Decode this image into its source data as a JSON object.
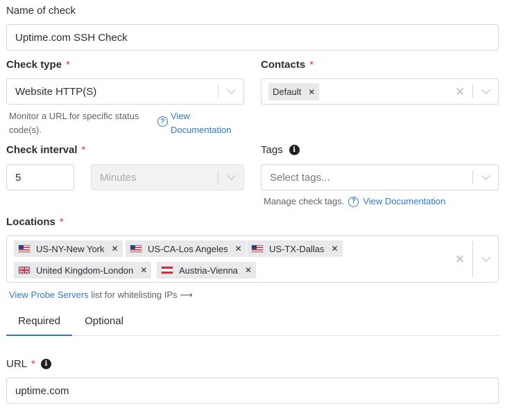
{
  "name_of_check": {
    "label": "Name of check",
    "value": "Uptime.com SSH Check"
  },
  "check_type": {
    "label": "Check type",
    "required_mark": "*",
    "value": "Website HTTP(S)",
    "helper": "Monitor a URL for specific status code(s).",
    "helper_line1": "Monitor a URL for specific status",
    "helper_line2": "code(s).",
    "doc_link_line1": "View",
    "doc_link_line2": "Documentation"
  },
  "contacts": {
    "label": "Contacts",
    "required_mark": "*",
    "chips": [
      {
        "label": "Default"
      }
    ]
  },
  "check_interval": {
    "label": "Check interval",
    "required_mark": "*",
    "value": "5",
    "unit": "Minutes"
  },
  "tags": {
    "label": "Tags",
    "placeholder": "Select tags...",
    "helper": "Manage check tags.",
    "doc_link": "View Documentation"
  },
  "locations": {
    "label": "Locations",
    "required_mark": "*",
    "chips": [
      {
        "label": "US-NY-New York",
        "flag": "us-flag-icon"
      },
      {
        "label": "US-CA-Los Angeles",
        "flag": "us-flag-icon"
      },
      {
        "label": "US-TX-Dallas",
        "flag": "us-flag-icon"
      },
      {
        "label": "United Kingdom-London",
        "flag": "uk-flag-icon"
      },
      {
        "label": "Austria-Vienna",
        "flag": "austria-flag-icon"
      }
    ],
    "probe_link": "View Probe Servers",
    "probe_text": "list for whitelisting IPs ⟶"
  },
  "tabs": [
    {
      "label": "Required",
      "active": true
    },
    {
      "label": "Optional",
      "active": false
    }
  ],
  "url": {
    "label": "URL",
    "required_mark": "*",
    "value": "uptime.com"
  },
  "colors": {
    "link": "#2f79c9",
    "required": "#d9363e",
    "tab_underline": "#2f79c9"
  }
}
